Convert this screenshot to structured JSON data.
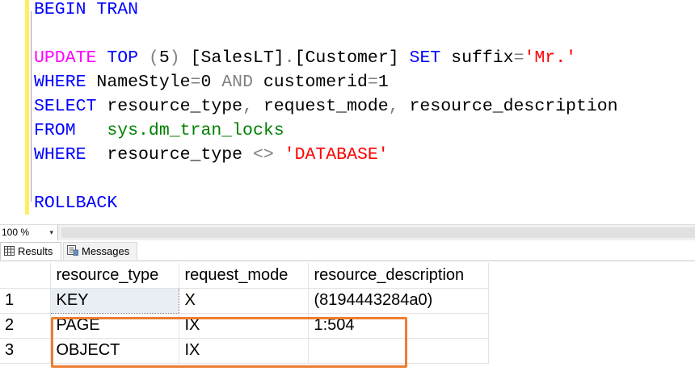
{
  "editor": {
    "lines": [
      [
        {
          "t": "BEGIN TRAN",
          "c": "kw"
        }
      ],
      [],
      [
        {
          "t": "UPDATE",
          "c": "fn"
        },
        {
          "t": " ",
          "c": "id"
        },
        {
          "t": "TOP",
          "c": "kw"
        },
        {
          "t": " (",
          "c": "op"
        },
        {
          "t": "5",
          "c": "id"
        },
        {
          "t": ") ",
          "c": "op"
        },
        {
          "t": "[SalesLT]",
          "c": "id"
        },
        {
          "t": ".",
          "c": "op"
        },
        {
          "t": "[Customer]",
          "c": "id"
        },
        {
          "t": " ",
          "c": "id"
        },
        {
          "t": "SET",
          "c": "kw"
        },
        {
          "t": " suffix",
          "c": "id"
        },
        {
          "t": "=",
          "c": "op"
        },
        {
          "t": "'Mr.'",
          "c": "str"
        }
      ],
      [
        {
          "t": "WHERE",
          "c": "kw"
        },
        {
          "t": " NameStyle",
          "c": "id"
        },
        {
          "t": "=",
          "c": "op"
        },
        {
          "t": "0 ",
          "c": "id"
        },
        {
          "t": "AND",
          "c": "op"
        },
        {
          "t": " customerid",
          "c": "id"
        },
        {
          "t": "=",
          "c": "op"
        },
        {
          "t": "1",
          "c": "id"
        }
      ],
      [
        {
          "t": "SELECT",
          "c": "kw"
        },
        {
          "t": " resource_type",
          "c": "id"
        },
        {
          "t": ",",
          "c": "op"
        },
        {
          "t": " request_mode",
          "c": "id"
        },
        {
          "t": ",",
          "c": "op"
        },
        {
          "t": " resource_description",
          "c": "id"
        }
      ],
      [
        {
          "t": "FROM",
          "c": "kw"
        },
        {
          "t": "   ",
          "c": "id"
        },
        {
          "t": "sys.dm_tran_locks",
          "c": "sys"
        }
      ],
      [
        {
          "t": "WHERE",
          "c": "kw"
        },
        {
          "t": "  resource_type ",
          "c": "id"
        },
        {
          "t": "<>",
          "c": "op"
        },
        {
          "t": " ",
          "c": "id"
        },
        {
          "t": "'DATABASE'",
          "c": "str"
        }
      ],
      [],
      [
        {
          "t": "ROLLBACK",
          "c": "kw"
        }
      ]
    ]
  },
  "zoom": {
    "value": "100 %",
    "arrow": "▾"
  },
  "tabs": [
    {
      "label": "Results",
      "icon": "grid-icon",
      "active": true
    },
    {
      "label": "Messages",
      "icon": "messages-icon",
      "active": false
    }
  ],
  "results": {
    "columns": [
      "resource_type",
      "request_mode",
      "resource_description"
    ],
    "rows": [
      {
        "num": "1",
        "resource_type": "KEY",
        "request_mode": "X",
        "resource_description": "(8194443284a0)"
      },
      {
        "num": "2",
        "resource_type": "PAGE",
        "request_mode": "IX",
        "resource_description": "1:504"
      },
      {
        "num": "3",
        "resource_type": "OBJECT",
        "request_mode": "IX",
        "resource_description": ""
      }
    ]
  },
  "colors": {
    "keyword": "#0000ff",
    "function": "#ff00ff",
    "system_object": "#008000",
    "string": "#ff0000",
    "operator": "#808080",
    "highlight_box": "#ed7d31"
  }
}
